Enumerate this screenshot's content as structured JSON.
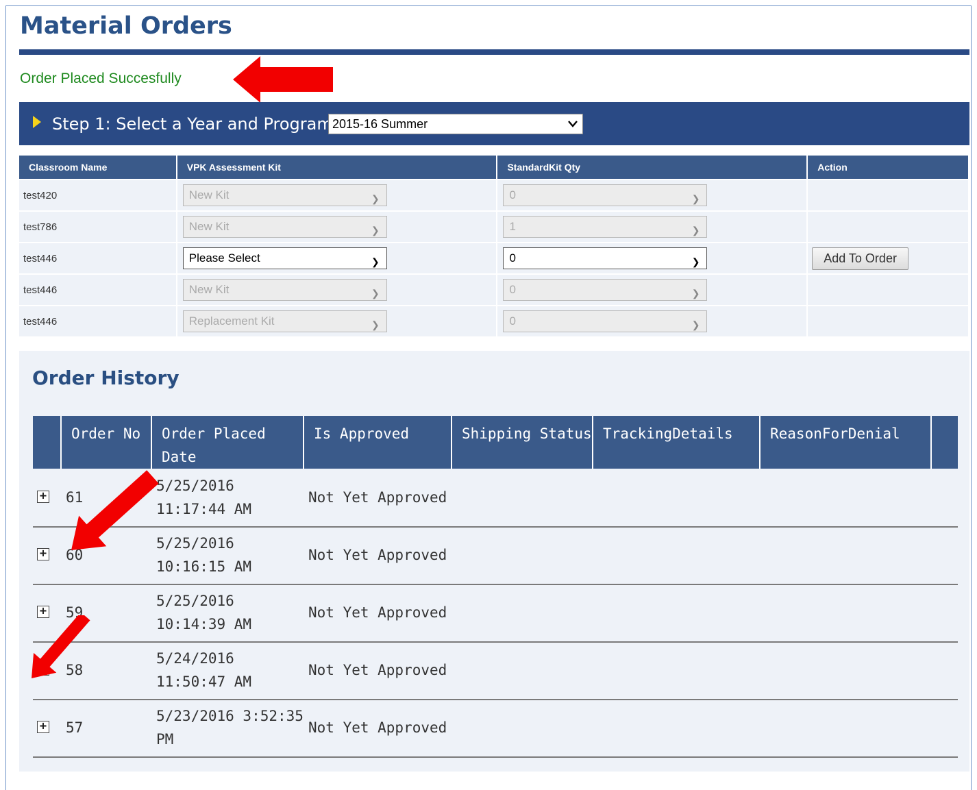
{
  "page": {
    "title": "Material Orders",
    "success_message": "Order Placed Succesfully"
  },
  "step1": {
    "label": "Step 1: Select a Year and Program",
    "selected_program": "2015-16 Summer"
  },
  "kit_table": {
    "headers": [
      "Classroom Name",
      "VPK Assessment Kit",
      "StandardKit Qty",
      "Action"
    ],
    "rows": [
      {
        "classroom": "test420",
        "kit": "New Kit",
        "qty": "0",
        "enabled": false,
        "action": ""
      },
      {
        "classroom": "test786",
        "kit": "New Kit",
        "qty": "1",
        "enabled": false,
        "action": ""
      },
      {
        "classroom": "test446",
        "kit": "Please Select",
        "qty": "0",
        "enabled": true,
        "action": "Add To Order"
      },
      {
        "classroom": "test446",
        "kit": "New Kit",
        "qty": "0",
        "enabled": false,
        "action": ""
      },
      {
        "classroom": "test446",
        "kit": "Replacement Kit",
        "qty": "0",
        "enabled": false,
        "action": ""
      }
    ]
  },
  "order_history": {
    "title": "Order History",
    "headers": [
      "Order No",
      "Order Placed Date",
      "Is Approved",
      "Shipping Status",
      "TrackingDetails",
      "ReasonForDenial"
    ],
    "rows": [
      {
        "order_no": "61",
        "date_line1": "5/25/2016",
        "date_line2": "11:17:44 AM",
        "approved": "Not Yet Approved"
      },
      {
        "order_no": "60",
        "date_line1": "5/25/2016",
        "date_line2": "10:16:15 AM",
        "approved": "Not Yet Approved"
      },
      {
        "order_no": "59",
        "date_line1": "5/25/2016",
        "date_line2": "10:14:39 AM",
        "approved": "Not Yet Approved"
      },
      {
        "order_no": "58",
        "date_line1": "5/24/2016",
        "date_line2": "11:50:47 AM",
        "approved": "Not Yet Approved"
      },
      {
        "order_no": "57",
        "date_line1": "5/23/2016 3:52:35",
        "date_line2": "PM",
        "approved": "Not Yet Approved"
      }
    ]
  },
  "icons": {
    "expand": "plus-box-icon",
    "step": "chevron-right-icon",
    "dropdown": "chevron-down-icon",
    "annotation": "red-arrow-icon"
  },
  "colors": {
    "header_blue": "#2a4a85",
    "title_blue": "#2a5288",
    "success_green": "#1f8a1f",
    "annotation_red": "#f20000"
  }
}
